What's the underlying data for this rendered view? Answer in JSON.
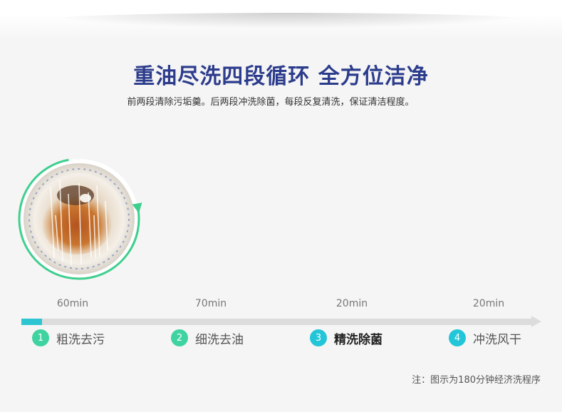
{
  "header": {
    "title": "重油尽洗四段循环  全方位洁净",
    "subtitle": "前两段清除污垢羹。后两段冲洗除菌，每段反复清洗，保证清洁程度。"
  },
  "colors": {
    "title": "#2c3c8c",
    "ring": "#3ecf8e",
    "track_fill": "#2ec5d3",
    "track_bg": "#dcdcdc",
    "stage_green": "#3fd3a0",
    "stage_cyan": "#22c6d8"
  },
  "progress": {
    "active_stage": 1,
    "fill_fraction": 0.04
  },
  "stages": [
    {
      "duration": "60min",
      "number": "1",
      "label": "粗洗去污",
      "color": "#3fd3a0"
    },
    {
      "duration": "70min",
      "number": "2",
      "label": "细洗去油",
      "color": "#3fd3a0"
    },
    {
      "duration": "20min",
      "number": "3",
      "label": "精洗除菌",
      "color": "#22c6d8"
    },
    {
      "duration": "20min",
      "number": "4",
      "label": "冲洗风干",
      "color": "#22c6d8"
    }
  ],
  "note": "注：图示为180分钟经济洗程序"
}
